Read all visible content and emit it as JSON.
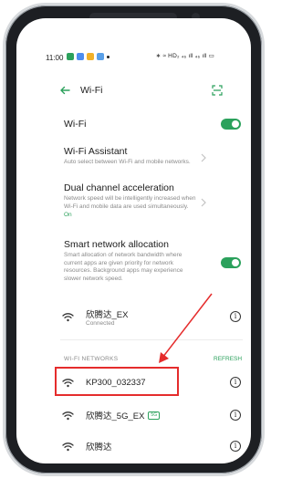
{
  "status_bar": {
    "time": "11:00",
    "right_text": "∗ ≈ HD₂ ₄₆ ıll ₄₆ ıll ▭"
  },
  "header": {
    "title": "Wi-Fi",
    "back_icon": "back-arrow-icon",
    "scan_icon": "scan-qr-icon"
  },
  "settings": {
    "wifi": {
      "label": "Wi-Fi",
      "enabled": true
    },
    "assistant": {
      "label": "Wi-Fi Assistant",
      "desc": "Auto select between Wi-Fi and mobile networks."
    },
    "dual": {
      "label": "Dual channel acceleration",
      "desc_line1": "Network speed will be intelligently increased when",
      "desc_line2": "Wi-Fi and mobile data are used simultaneously.",
      "state": "On"
    },
    "smart": {
      "label": "Smart network allocation",
      "desc_line1": "Smart allocation of network bandwidth where",
      "desc_line2": "current apps are given priority for network",
      "desc_line3": "resources. Background apps may experience",
      "desc_line4": "slower network speed.",
      "enabled": true
    }
  },
  "connected": {
    "name": "欣腾达_EX",
    "status": "Connected"
  },
  "networks_section": {
    "title": "WI-FI NETWORKS",
    "refresh": "REFRESH"
  },
  "networks": [
    {
      "name": "KP300_032337"
    },
    {
      "name": "欣腾达_5G_EX",
      "badge": "5G"
    },
    {
      "name": "欣腾达"
    }
  ],
  "info_glyph": "i",
  "nav": {
    "menu_glyph": "≡",
    "home_glyph": "□",
    "back_glyph": "◁",
    "accessibility_glyph": "🕴"
  },
  "colors": {
    "accent": "#2ba15c",
    "annotation": "#e52c2c"
  }
}
